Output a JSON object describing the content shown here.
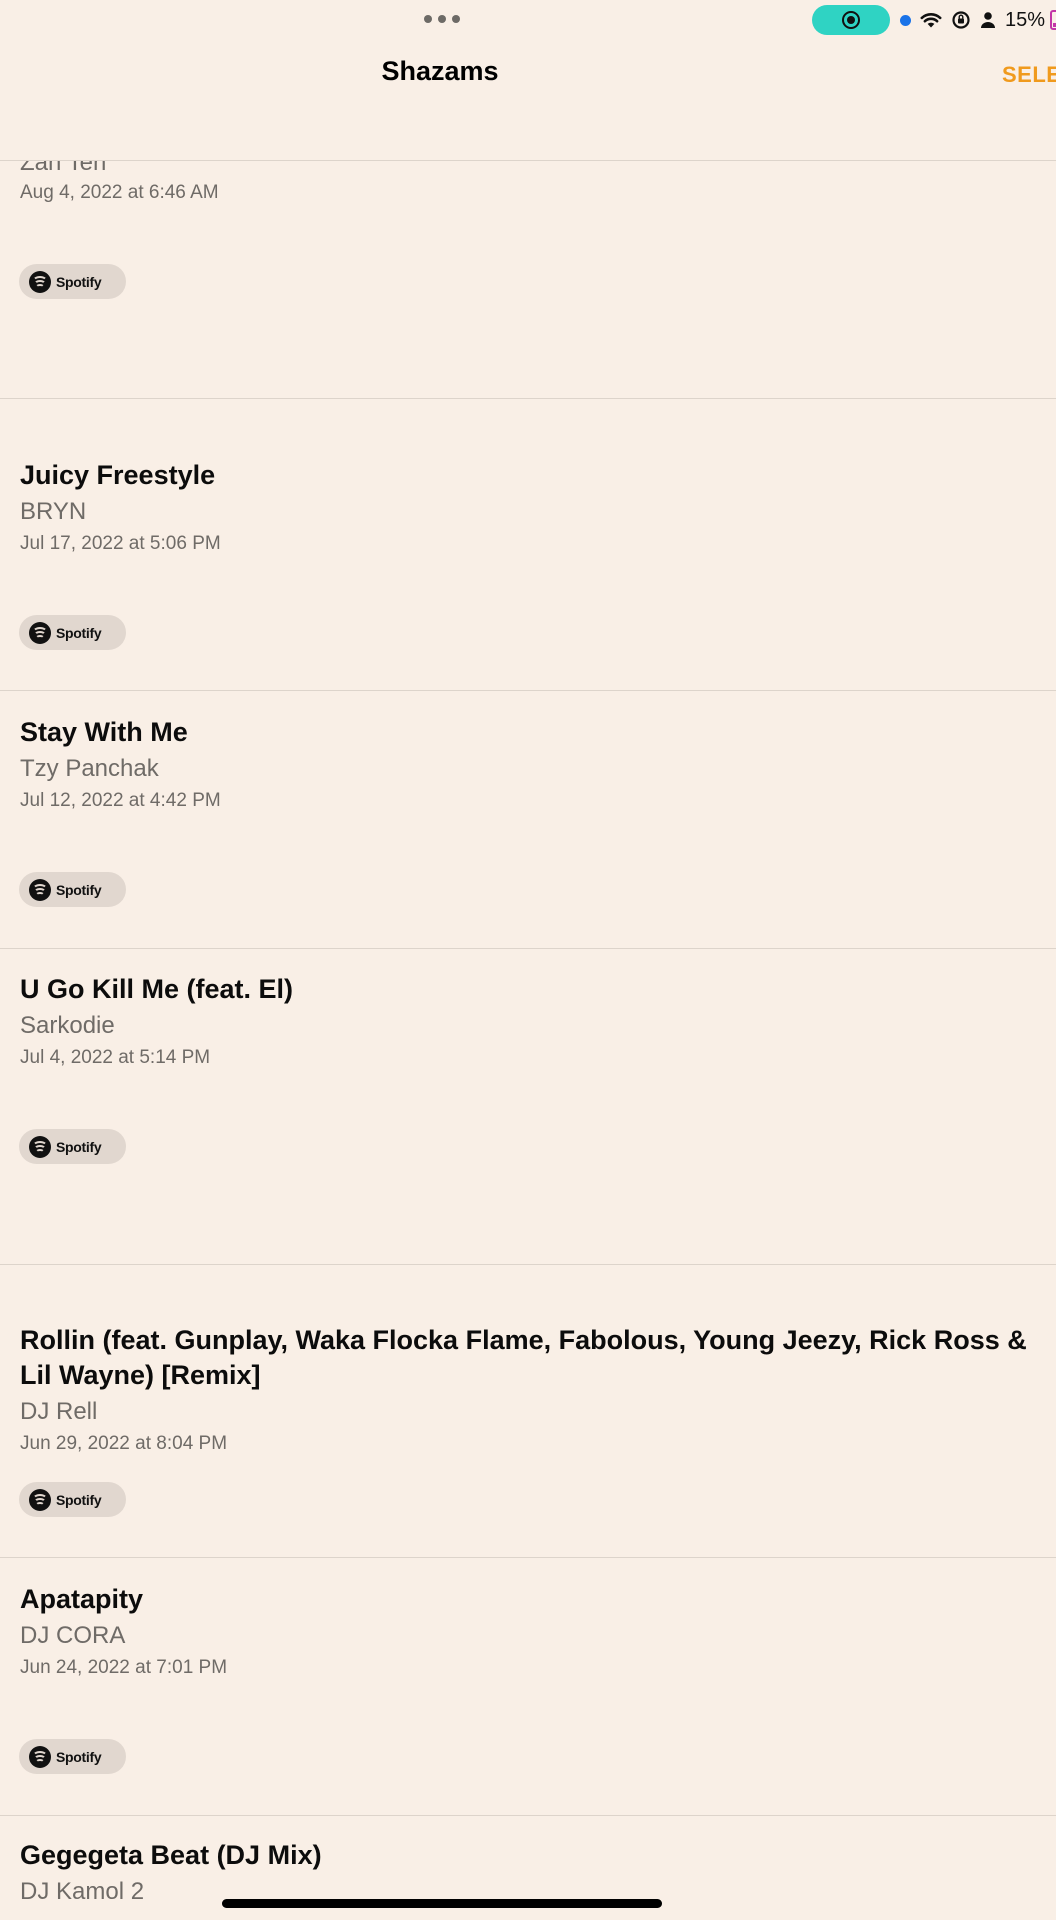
{
  "status_bar": {
    "battery_text": "15%",
    "icons": [
      "more-dots-icon",
      "screen-record-icon",
      "location-dot-icon",
      "wifi-icon",
      "orientation-lock-icon",
      "person-icon",
      "battery-icon"
    ]
  },
  "nav": {
    "title": "Shazams",
    "select_label": "SELE"
  },
  "partial_top": {
    "artist": "Zan Ten",
    "date": "Aug 4, 2022 at 6:46 AM",
    "provider": "Spotify"
  },
  "songs": [
    {
      "title": "Juicy Freestyle",
      "artist": "BRYN",
      "date": "Jul 17, 2022 at 5:06 PM",
      "provider": "Spotify"
    },
    {
      "title": "Stay With Me",
      "artist": "Tzy Panchak",
      "date": "Jul 12, 2022 at 4:42 PM",
      "provider": "Spotify"
    },
    {
      "title": "U Go Kill Me (feat. El)",
      "artist": "Sarkodie",
      "date": "Jul 4, 2022 at 5:14 PM",
      "provider": "Spotify"
    },
    {
      "title": "Rollin (feat. Gunplay, Waka Flocka Flame, Fabolous, Young Jeezy, Rick Ross & Lil Wayne) [Remix]",
      "artist": "DJ Rell",
      "date": "Jun 29, 2022 at 8:04 PM",
      "provider": "Spotify"
    },
    {
      "title": "Apatapity",
      "artist": "DJ CORA",
      "date": "Jun 24, 2022 at 7:01 PM",
      "provider": "Spotify"
    },
    {
      "title": "Gegegeta Beat (DJ Mix)",
      "artist": "DJ Kamol 2",
      "date": "",
      "provider": ""
    }
  ],
  "colors": {
    "background": "#f9efe6",
    "accent": "#f09a1d",
    "separator": "#ddd4cb",
    "secondary_text": "#6f6b67",
    "record_pill": "#2fd3c3"
  }
}
